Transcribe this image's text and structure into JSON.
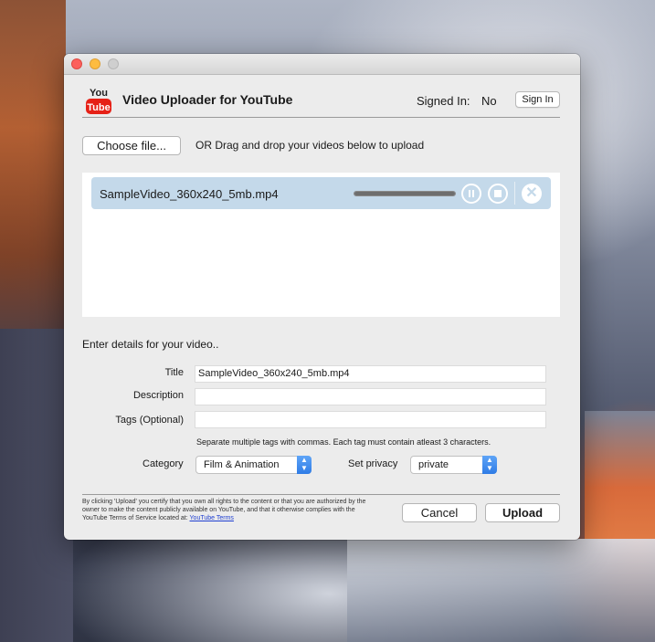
{
  "app": {
    "title": "Video Uploader for YouTube",
    "logo_text_top": "You",
    "logo_text_bottom": "Tube"
  },
  "account": {
    "signed_in_label": "Signed In:",
    "signed_in_value": "No",
    "sign_in_button": "Sign In"
  },
  "upload": {
    "choose_button": "Choose file...",
    "drag_hint": "OR Drag and drop your videos below to upload"
  },
  "queue": {
    "items": [
      {
        "file_name": "SampleVideo_360x240_5mb.mp4",
        "progress": 1.0
      }
    ]
  },
  "details": {
    "heading": "Enter details for your video..",
    "title_label": "Title",
    "title_value": "SampleVideo_360x240_5mb.mp4",
    "description_label": "Description",
    "description_value": "",
    "tags_label": "Tags (Optional)",
    "tags_value": "",
    "tags_hint": "Separate multiple tags with commas. Each tag must contain atleast 3 characters.",
    "category_label": "Category",
    "category_value": "Film & Animation",
    "privacy_label": "Set privacy",
    "privacy_value": "private"
  },
  "footer": {
    "disclaimer": "By clicking 'Upload' you certify that you own all rights to the content or that you are authorized by the owner to make the content publicly available on YouTube, and that it otherwise complies with the YouTube Terms of Service located at:",
    "terms_link": "YouTube Terms",
    "cancel_button": "Cancel",
    "upload_button": "Upload"
  },
  "colors": {
    "file_row_bg": "#c4d9ea",
    "select_accent": "#2f7ce6",
    "youtube_red": "#e62117"
  },
  "icons": {
    "pause": "pause-icon",
    "stop": "stop-icon",
    "remove": "remove-icon",
    "select_arrows": "chevron-updown-icon"
  }
}
